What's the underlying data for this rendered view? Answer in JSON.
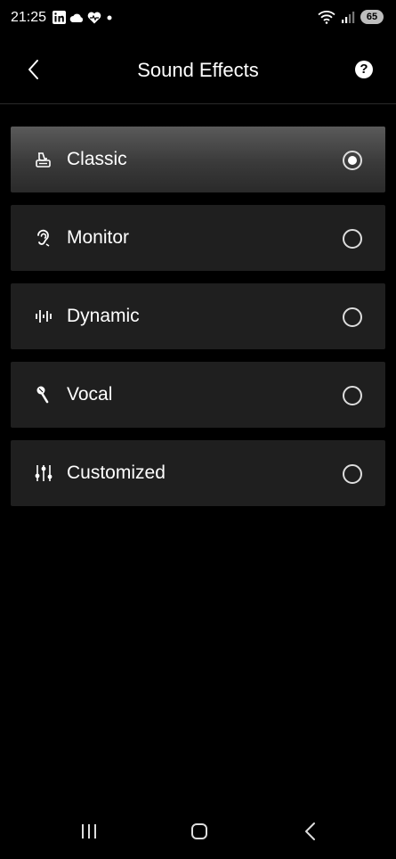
{
  "status_bar": {
    "time": "21:25",
    "battery": "65",
    "icons": [
      "linkedin-icon",
      "cloud-icon",
      "heart-icon",
      "dot-icon",
      "wifi-icon",
      "signal-icon",
      "battery-icon"
    ]
  },
  "header": {
    "title": "Sound Effects",
    "back_icon": "chevron-left-icon",
    "help_label": "?"
  },
  "effects": [
    {
      "label": "Classic",
      "icon": "gramophone-icon",
      "selected": true
    },
    {
      "label": "Monitor",
      "icon": "ear-icon",
      "selected": false
    },
    {
      "label": "Dynamic",
      "icon": "waveform-icon",
      "selected": false
    },
    {
      "label": "Vocal",
      "icon": "microphone-icon",
      "selected": false
    },
    {
      "label": "Customized",
      "icon": "sliders-icon",
      "selected": false
    }
  ],
  "nav_bar": {
    "buttons": [
      "recents-icon",
      "home-icon",
      "back-icon"
    ]
  }
}
